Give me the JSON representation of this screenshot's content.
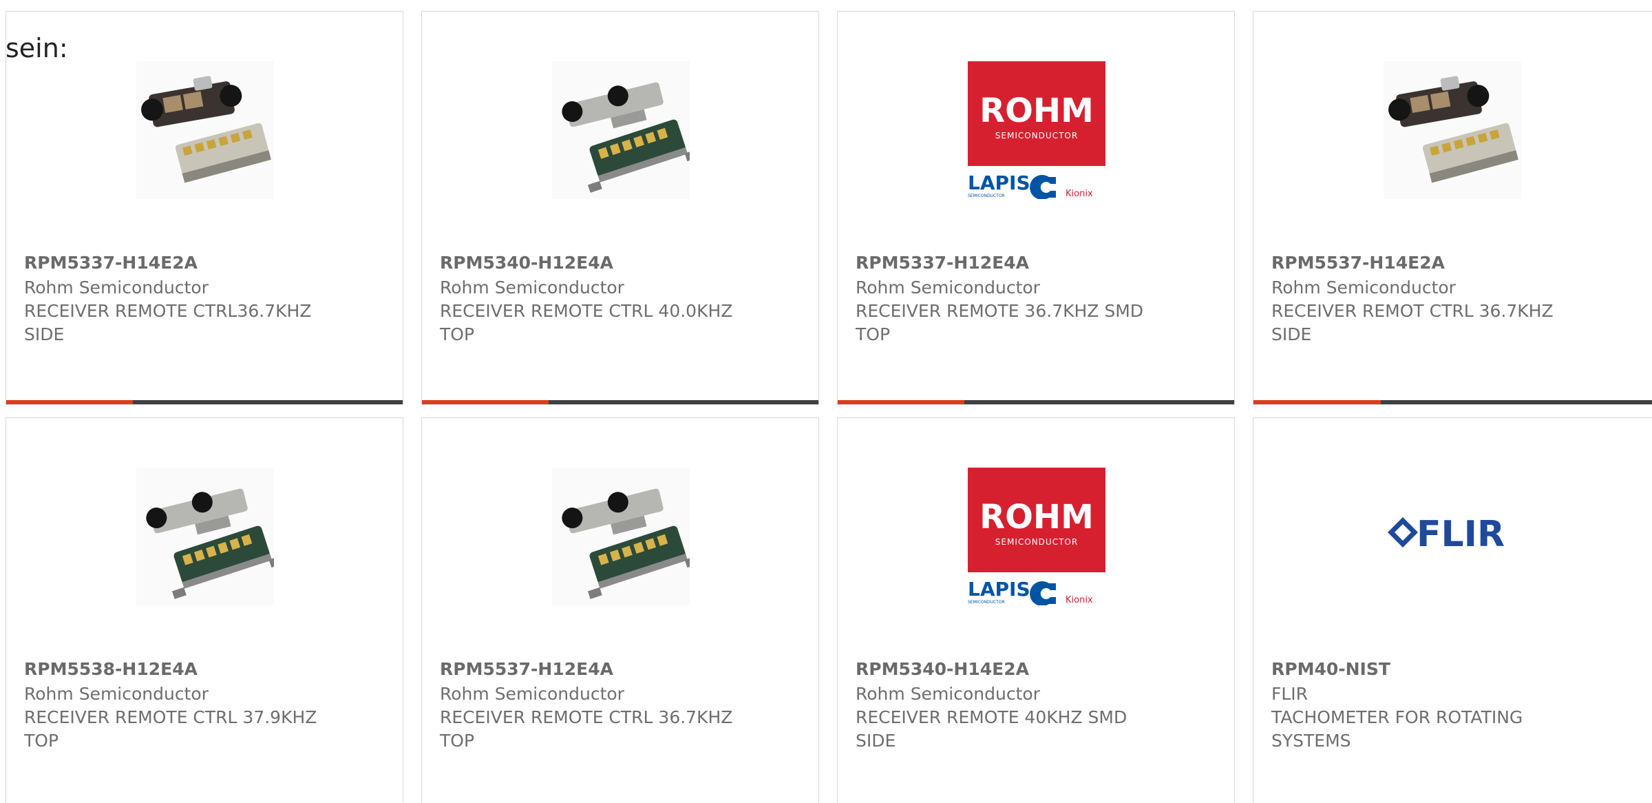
{
  "intro": {
    "text": "sein:"
  },
  "colors": {
    "accent": "#e03c14",
    "bar": "#404040",
    "border": "#d8d8d8",
    "rohm_red": "#d7202f",
    "lapis_blue": "#0054a6",
    "flir_blue": "#1f4a9c"
  },
  "cards": [
    {
      "part_number": "RPM5337-H14E2A",
      "manufacturer": "Rohm Semiconductor",
      "description": "RECEIVER REMOTE CTRL36.7KHZ SIDE",
      "image": "sensor-module-side-image",
      "progress": 0.32
    },
    {
      "part_number": "RPM5340-H12E4A",
      "manufacturer": "Rohm Semiconductor",
      "description": "RECEIVER REMOTE CTRL 40.0KHZ TOP",
      "image": "sensor-module-top-image",
      "progress": 0.32
    },
    {
      "part_number": "RPM5337-H12E4A",
      "manufacturer": "Rohm Semiconductor",
      "description": "RECEIVER REMOTE 36.7KHZ SMD TOP",
      "image": "rohm-logo-image",
      "progress": 0.32
    },
    {
      "part_number": "RPM5537-H14E2A",
      "manufacturer": "Rohm Semiconductor",
      "description": "RECEIVER REMOT CTRL 36.7KHZ SIDE",
      "image": "sensor-module-side-image",
      "progress": 0.32
    },
    {
      "part_number": "RPM5538-H12E4A",
      "manufacturer": "Rohm Semiconductor",
      "description": "RECEIVER REMOTE CTRL 37.9KHZ TOP",
      "image": "sensor-module-top-image"
    },
    {
      "part_number": "RPM5537-H12E4A",
      "manufacturer": "Rohm Semiconductor",
      "description": "RECEIVER REMOTE CTRL 36.7KHZ TOP",
      "image": "sensor-module-top-image"
    },
    {
      "part_number": "RPM5340-H14E2A",
      "manufacturer": "Rohm Semiconductor",
      "description": "RECEIVER REMOTE 40KHZ SMD SIDE",
      "image": "rohm-logo-image"
    },
    {
      "part_number": "RPM40-NIST",
      "manufacturer": "FLIR",
      "description": "TACHOMETER FOR ROTATING SYSTEMS",
      "image": "flir-logo-image"
    }
  ],
  "logos": {
    "rohm_word": "ROHM",
    "rohm_sub": "SEMICONDUCTOR",
    "lapis_word": "LAPIS",
    "lapis_sub": "SEMICONDUCTOR",
    "kionix_word": "Kionix",
    "flir_word": "FLIR"
  }
}
